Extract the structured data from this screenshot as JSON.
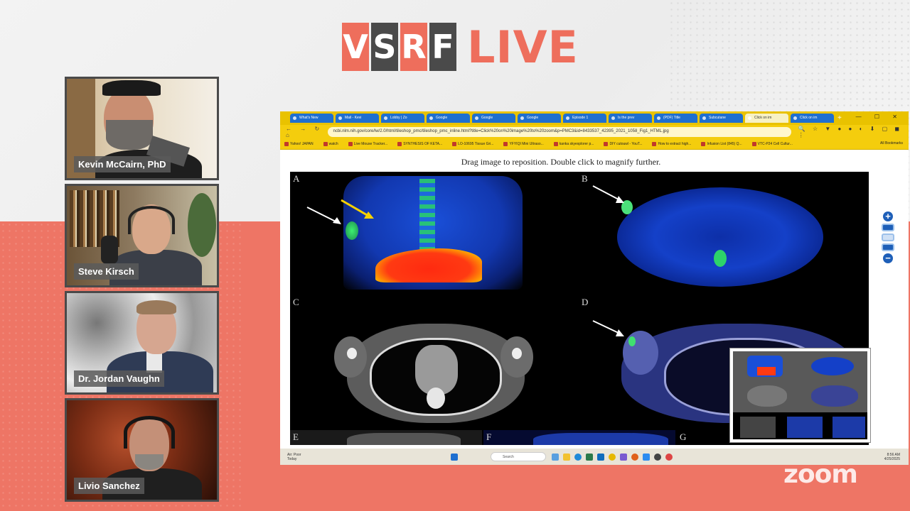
{
  "brand": {
    "letters": [
      "V",
      "S",
      "R",
      "F"
    ],
    "live_label": "LIVE",
    "watermark": "zoom"
  },
  "participants": [
    {
      "name": "Kevin McCairn, PhD"
    },
    {
      "name": "Steve Kirsch"
    },
    {
      "name": "Dr. Jordan Vaughn"
    },
    {
      "name": "Livio Sanchez"
    }
  ],
  "browser": {
    "tabs": [
      "What's New",
      "Mail - Kevi",
      "Lobby | Zo",
      "Google",
      "Google",
      "Google",
      "Episode 1",
      "Is the prev",
      "(PDF) Title",
      "Subcutane",
      "Click on im",
      "Click on im"
    ],
    "active_tab_index": 10,
    "new_tab": "+",
    "window_controls": "— ☐ ✕",
    "nav_icons": "← → ↻ ⌂",
    "url": "ncbi.nlm.nih.gov/core/lw/2.0/html/tileshop_pmc/tileshop_pmc_inline.html?title=Click%20on%20image%20to%20zoom&p=PMC3&id=8433537_42395_2021_1058_Fig1_HTML.jpg",
    "ext_icons": "🔍 ☆ ▼ ● ● ◐ ⬇ ▢ ◼ ⋮",
    "bookmarks": [
      "Yahoo! JAPAN",
      "watch",
      "Live Mouse Tracker...",
      "SYNTHESIS OF KETA...",
      "LO-10695 Tissue Gri...",
      "YFYIQI Mini Ultraso...",
      "kanka skyexplorer p...",
      "DIY cutouwl - YouT...",
      "How to extract high...",
      "Infusion List (845) Q...",
      "VTC-P24 Cell Cultur..."
    ],
    "all_bookmarks": "All Bookmarks"
  },
  "viewer": {
    "instruction": "Drag image to reposition. Double click to magnify further.",
    "panel_labels": [
      "A",
      "B",
      "C",
      "D",
      "E",
      "F",
      "G"
    ],
    "zoom_in": "+",
    "zoom_out": "−"
  },
  "taskbar": {
    "weather_line1": "Air: Poor",
    "weather_line2": "Today",
    "search_placeholder": "Search",
    "time": "8:56 AM",
    "date": "4/25/2025"
  }
}
